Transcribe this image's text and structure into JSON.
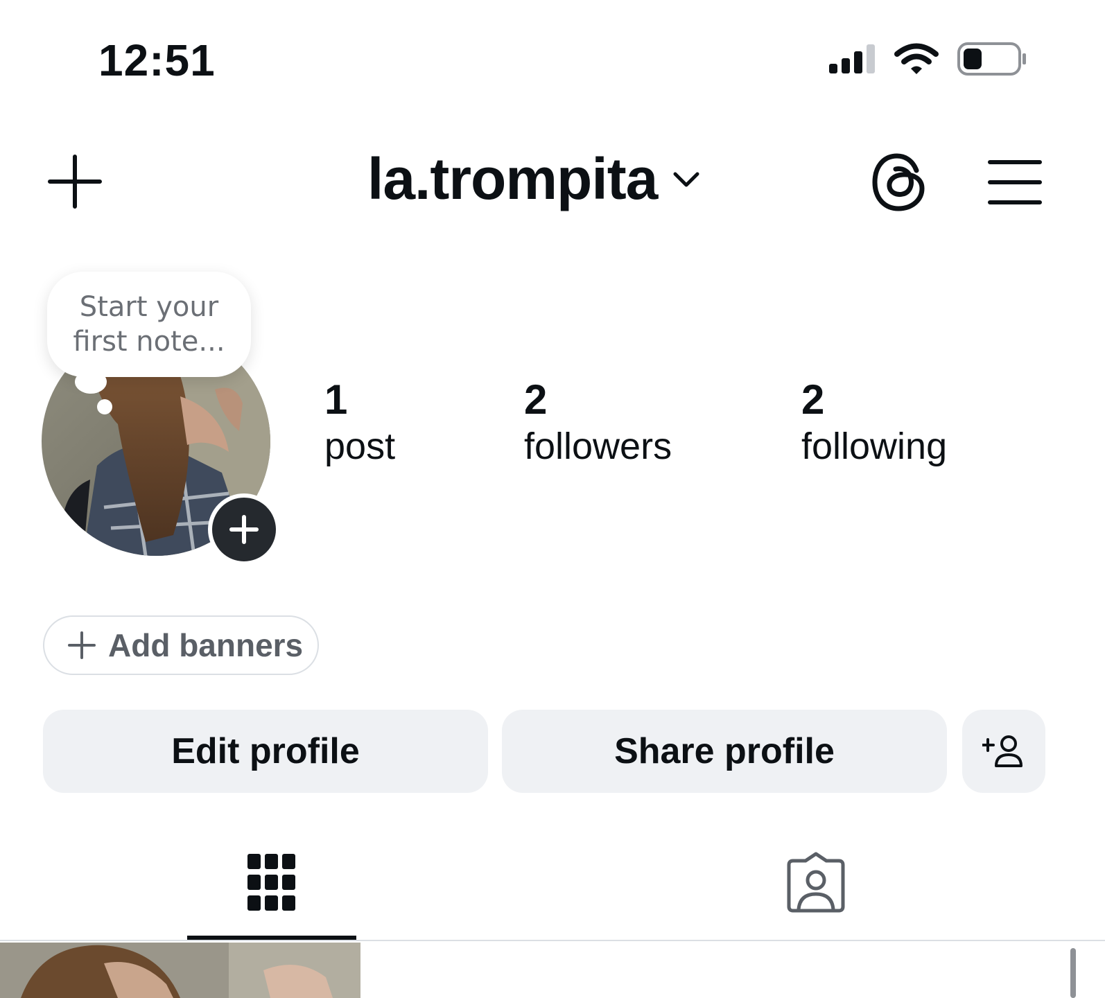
{
  "status_bar": {
    "time": "12:51",
    "icons": [
      "cellular-signal-icon",
      "wifi-icon",
      "battery-icon"
    ]
  },
  "header": {
    "username": "la.trompita",
    "icons": [
      "plus-icon",
      "chevron-down-icon",
      "threads-icon",
      "hamburger-menu-icon"
    ]
  },
  "note": {
    "placeholder_line1": "Start your",
    "placeholder_line2": "first note..."
  },
  "stats": {
    "posts": {
      "count": "1",
      "label": "post"
    },
    "followers": {
      "count": "2",
      "label": "followers"
    },
    "following": {
      "count": "2",
      "label": "following"
    }
  },
  "banners": {
    "label": "Add banners"
  },
  "buttons": {
    "edit_profile": "Edit profile",
    "share_profile": "Share profile"
  },
  "tabs": [
    {
      "icon": "grid-icon",
      "active": true
    },
    {
      "icon": "tagged-person-icon",
      "active": false
    }
  ],
  "colors": {
    "text": "#0c1014",
    "button_bg": "#eff1f4",
    "muted_text": "#6b6f75",
    "border": "#dbdfe4"
  }
}
